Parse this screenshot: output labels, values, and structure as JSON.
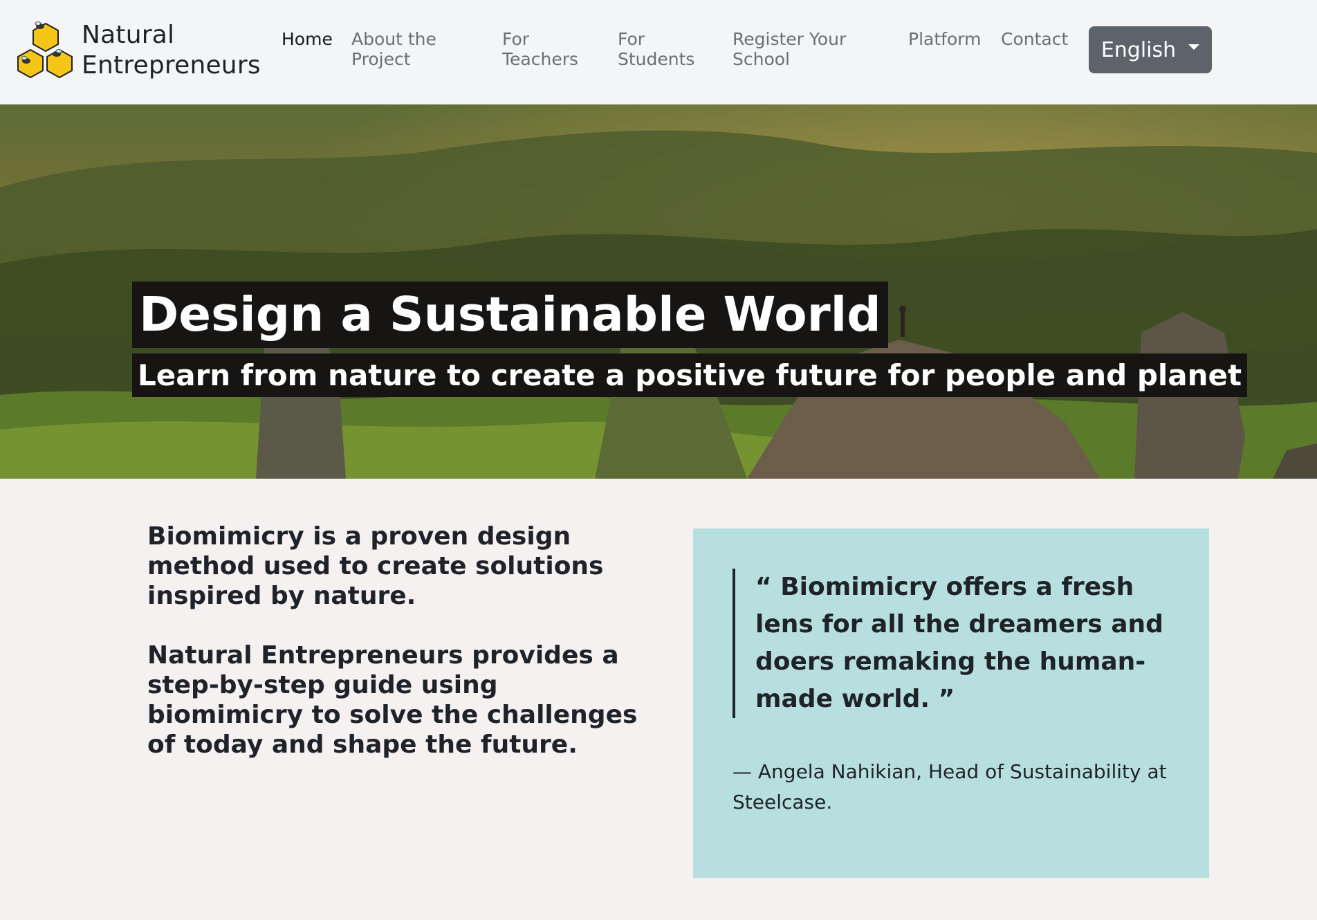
{
  "brand": {
    "logo_icon": "honeycomb-bees-icon",
    "name_line1": "Natural",
    "name_line2": "Entrepreneurs"
  },
  "nav": {
    "home": "Home",
    "about_line1": "About the",
    "about_line2": "Project",
    "teachers_line1": "For",
    "teachers_line2": "Teachers",
    "students_line1": "For",
    "students_line2": "Students",
    "register_line1": "Register Your",
    "register_line2": "School",
    "platform": "Platform",
    "contact": "Contact",
    "language": "English"
  },
  "hero": {
    "title": "Design a Sustainable World",
    "subtitle": "Learn from nature to create a positive future for people and planet"
  },
  "intro": {
    "paragraph1": "Biomimicry is a proven design method used to create solutions inspired by nature.",
    "paragraph2": "Natural Entrepreneurs provides a step-by-step guide using biomimicry to solve the challenges of today and shape the future."
  },
  "quote": {
    "text": "“ Biomimicry offers a fresh lens for all the dreamers and doers remaking the human-made world. ”",
    "author": "— Angela Nahikian, Head of Sustainability at Steelcase."
  },
  "colors": {
    "nav_bg": "#f4f5f7",
    "page_bg": "#f5f1f0",
    "button_bg": "#5c636a",
    "quote_bg": "#b7dfe0",
    "hero_label_bg": "#161514"
  }
}
